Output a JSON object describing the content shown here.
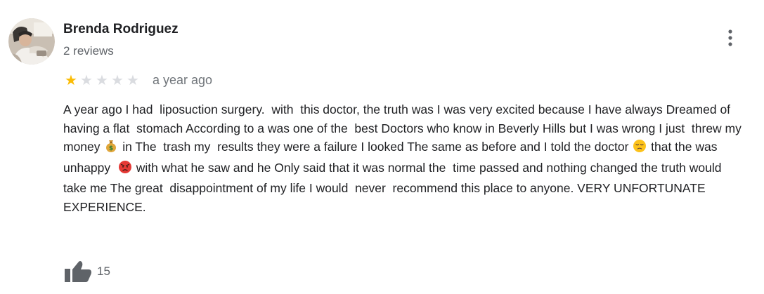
{
  "review": {
    "author": {
      "name": "Brenda Rodriguez",
      "reviews_count": "2 reviews",
      "avatar_icon": "profile-photo"
    },
    "rating": {
      "value": 1,
      "max": 5,
      "filled_color": "#fbbc04",
      "empty_color": "#dadce0"
    },
    "date": "a year ago",
    "text_segments": [
      {
        "type": "text",
        "value": "A year ago I had  liposuction surgery.  with  this doctor, the truth was I was very excited because I have always Dreamed of  having a flat  stomach According to a was one of the  best Doctors who know in Beverly Hills but I was wrong I just  threw my  money "
      },
      {
        "type": "emoji",
        "icon": "money-bag-icon"
      },
      {
        "type": "text",
        "value": " in The  trash my  results they were a failure I looked The same as before and I told the doctor "
      },
      {
        "type": "emoji",
        "icon": "pensive-face-icon"
      },
      {
        "type": "text",
        "value": " that the was unhappy  "
      },
      {
        "type": "emoji",
        "icon": "angry-face-icon"
      },
      {
        "type": "text",
        "value": " with what he saw and he Only said that it was normal the  time passed and nothing changed the truth would take me The great  disappointment of my life I would  never  recommend this place to anyone. VERY UNFORTUNATE EXPERIENCE."
      }
    ],
    "likes": {
      "count": "15",
      "icon": "thumbs-up-icon"
    },
    "more_menu_icon": "more-vertical-icon"
  }
}
